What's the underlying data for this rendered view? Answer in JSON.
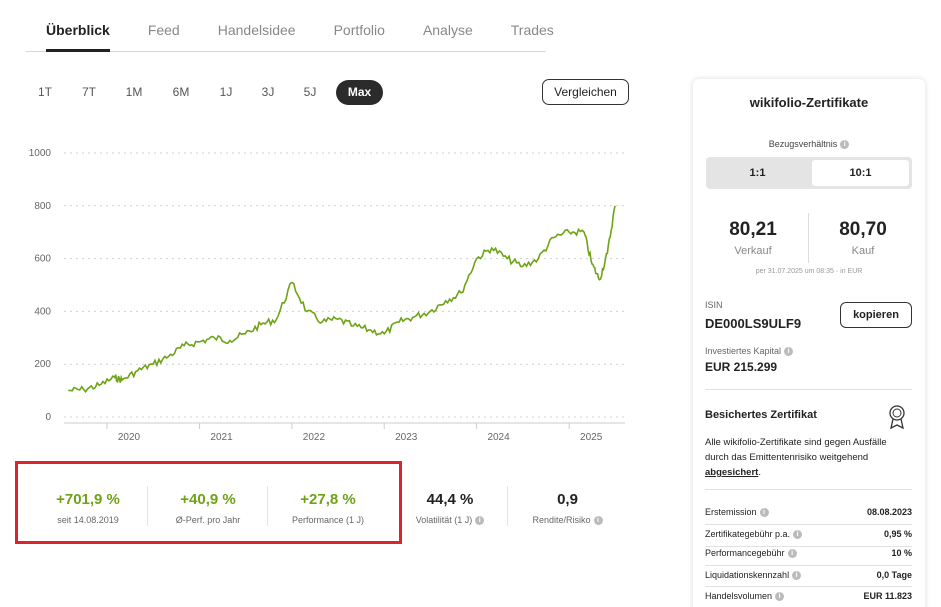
{
  "tabs": [
    "Überblick",
    "Feed",
    "Handelsidee",
    "Portfolio",
    "Analyse",
    "Trades"
  ],
  "ranges": [
    "1T",
    "7T",
    "1M",
    "6M",
    "1J",
    "3J",
    "5J",
    "Max"
  ],
  "compare_label": "Vergleichen",
  "chart_data": {
    "type": "line",
    "x_tick_labels": [
      "2020",
      "2021",
      "2022",
      "2023",
      "2024",
      "2025"
    ],
    "y_tick_labels": [
      "0",
      "200",
      "400",
      "600",
      "800",
      "1000"
    ],
    "ylim": [
      0,
      1000
    ],
    "xlim": [
      "2019-08-14",
      "2025-07-31"
    ],
    "grid": true,
    "color": "#6ea316",
    "x": [
      "2019-08",
      "2019-10",
      "2019-12",
      "2020-02",
      "2020-03",
      "2020-05",
      "2020-07",
      "2020-09",
      "2020-11",
      "2021-01",
      "2021-03",
      "2021-05",
      "2021-07",
      "2021-09",
      "2021-11",
      "2022-01",
      "2022-03",
      "2022-05",
      "2022-07",
      "2022-09",
      "2022-11",
      "2023-01",
      "2023-03",
      "2023-05",
      "2023-07",
      "2023-09",
      "2023-11",
      "2024-01",
      "2024-03",
      "2024-05",
      "2024-07",
      "2024-09",
      "2024-11",
      "2025-01",
      "2025-03",
      "2025-04",
      "2025-05",
      "2025-06",
      "2025-07"
    ],
    "y": [
      100,
      104,
      120,
      150,
      140,
      175,
      200,
      230,
      270,
      285,
      300,
      290,
      315,
      350,
      370,
      510,
      400,
      360,
      370,
      345,
      330,
      315,
      360,
      380,
      400,
      440,
      470,
      600,
      640,
      600,
      570,
      600,
      680,
      700,
      700,
      580,
      520,
      620,
      800
    ]
  },
  "stats": [
    {
      "value": "+701,9 %",
      "label": "seit 14.08.2019"
    },
    {
      "value": "+40,9 %",
      "label": "Ø-Perf. pro Jahr"
    },
    {
      "value": "+27,8 %",
      "label": "Performance (1 J)"
    },
    {
      "value": "44,4 %",
      "label": "Volatilität (1 J)"
    },
    {
      "value": "0,9",
      "label": "Rendite/Risiko"
    }
  ],
  "panel": {
    "title": "wikifolio-Zertifikate",
    "ratio_label": "Bezugsverhältnis",
    "ratio_options": [
      "1:1",
      "10:1"
    ],
    "sell_price": "80,21",
    "sell_label": "Verkauf",
    "buy_price": "80,70",
    "buy_label": "Kauf",
    "price_note": "per 31.07.2025 um 08:35 · in EUR",
    "isin_label": "ISIN",
    "isin": "DE000LS9ULF9",
    "copy_label": "kopieren",
    "capital_label": "Investiertes Kapital",
    "capital": "EUR 215.299",
    "cert_title": "Besichertes Zertifikat",
    "cert_text": "Alle wikifolio-Zertifikate sind gegen Ausfälle durch das Emittentenrisiko weitgehend",
    "cert_link": "abgesichert",
    "details": [
      {
        "key": "Erstemission",
        "value": "08.08.2023"
      },
      {
        "key": "Zertifikategebühr p.a.",
        "value": "0,95 %"
      },
      {
        "key": "Performancegebühr",
        "value": "10 %"
      },
      {
        "key": "Liquidationskennzahl",
        "value": "0,0 Tage"
      },
      {
        "key": "Handelsvolumen",
        "value": "EUR 11.823"
      }
    ]
  },
  "colors": {
    "positive": "#6ea316",
    "highlight_border": "#d9262e",
    "active_range": "#2b2b2b"
  }
}
